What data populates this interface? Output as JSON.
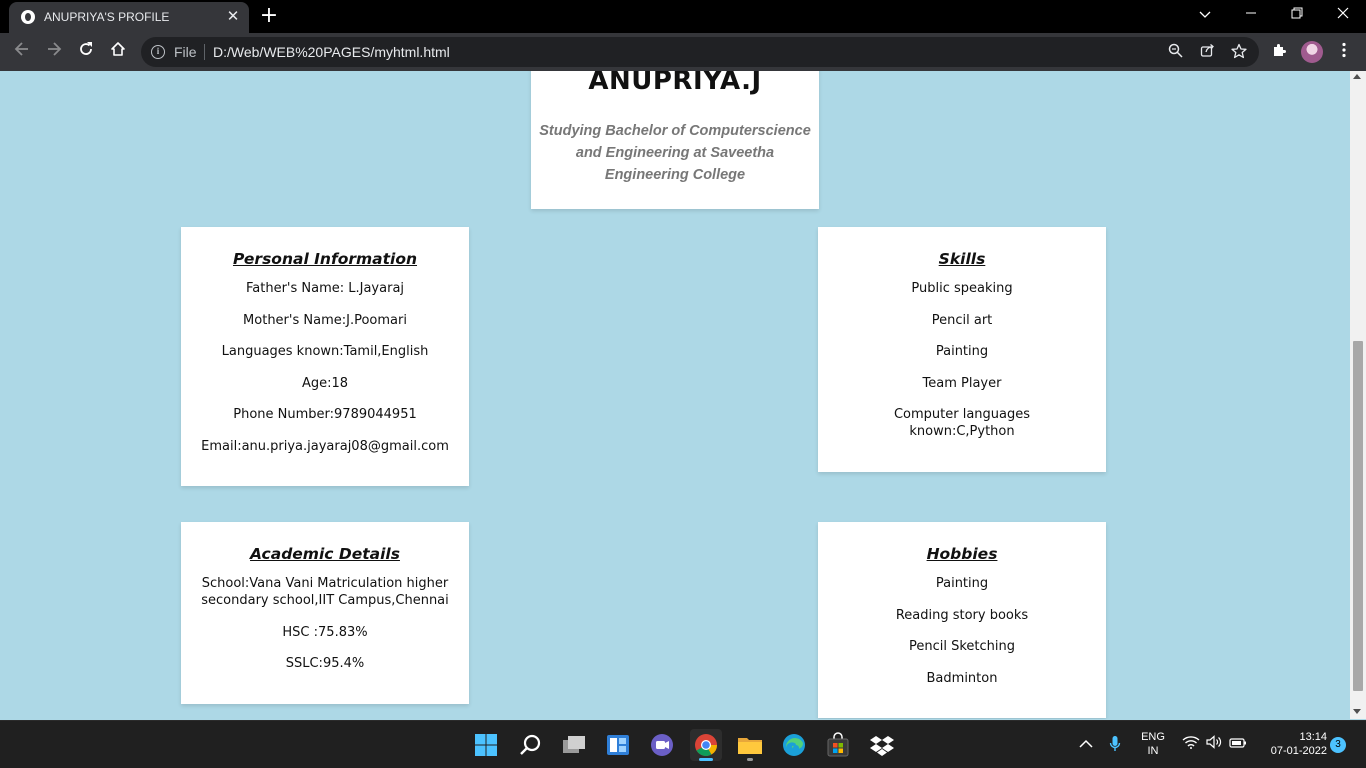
{
  "browser": {
    "tab_title": "ANUPRIYA'S PROFILE",
    "tab_close": "✕",
    "new_tab": "+",
    "omnibox_scheme": "File",
    "url": "D:/Web/WEB%20PAGES/myhtml.html",
    "icons": [
      "back-icon",
      "forward-icon",
      "reload-icon",
      "home-icon",
      "info-icon",
      "zoom-icon",
      "share-icon",
      "star-icon",
      "extensions-icon",
      "profile-avatar",
      "menu-icon"
    ]
  },
  "profile": {
    "name": "ANUPRIYA.J",
    "subtitle": "Studying Bachelor of Computerscience and Engineering at Saveetha Engineering College"
  },
  "personal": {
    "heading": "Personal Information",
    "items": [
      "Father's Name: L.Jayaraj",
      "Mother's Name:J.Poomari",
      "Languages known:Tamil,English",
      "Age:18",
      "Phone Number:9789044951",
      "Email:anu.priya.jayaraj08@gmail.com"
    ]
  },
  "skills": {
    "heading": "Skills",
    "items": [
      "Public speaking",
      "Pencil art",
      "Painting",
      "Team Player",
      "Computer languages known:C,Python"
    ]
  },
  "academic": {
    "heading": "Academic Details",
    "items": [
      "School:Vana Vani Matriculation higher secondary school,IIT Campus,Chennai",
      "HSC :75.83%",
      "SSLC:95.4%"
    ]
  },
  "hobbies": {
    "heading": "Hobbies",
    "items": [
      "Painting",
      "Reading story books",
      "Pencil Sketching",
      "Badminton"
    ]
  },
  "taskbar": {
    "lang_top": "ENG",
    "lang_bottom": "IN",
    "time": "13:14",
    "date": "07-01-2022",
    "notifications": "3"
  },
  "colors": {
    "page_background": "#add8e6",
    "card_background": "#ffffff",
    "subtitle_text": "#777777",
    "taskbar": "#202020"
  }
}
